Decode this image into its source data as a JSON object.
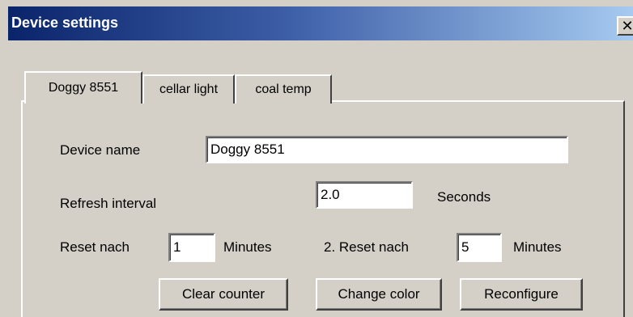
{
  "window": {
    "title": "Device settings",
    "close_glyph": "✕"
  },
  "tabs": [
    {
      "label": "Doggy 8551",
      "active": true
    },
    {
      "label": "cellar light",
      "active": false
    },
    {
      "label": "coal temp",
      "active": false
    }
  ],
  "form": {
    "device_name_label": "Device name",
    "device_name_value": "Doggy 8551",
    "refresh_label": "Refresh interval",
    "refresh_value": "2.0",
    "refresh_unit": "Seconds",
    "reset1_label": "Reset nach",
    "reset1_value": "1",
    "reset1_unit": "Minutes",
    "reset2_label": "2. Reset nach",
    "reset2_value": "5",
    "reset2_unit": "Minutes"
  },
  "buttons": {
    "clear_counter": "Clear counter",
    "change_color": "Change color",
    "reconfigure": "Reconfigure"
  },
  "icons": {
    "close": "close-icon"
  }
}
